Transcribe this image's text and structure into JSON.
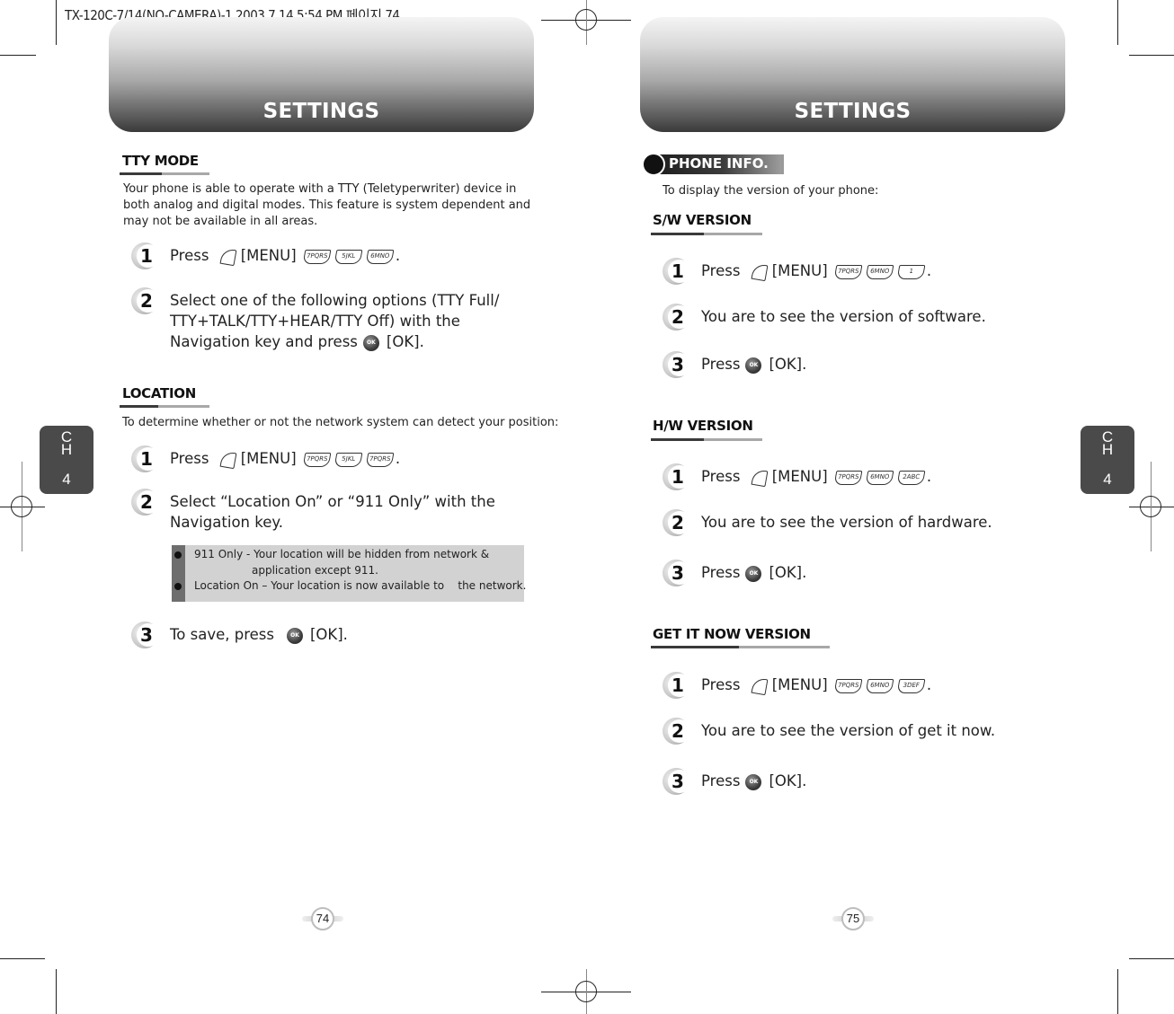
{
  "print_header": "TX-120C-7/14(NO-CAMERA)-1  2003.7.14 5:54 PM 페이지 74",
  "left_page": {
    "banner_title": "SETTINGS",
    "chapter_tab": {
      "letters": "C\nH",
      "number": "4"
    },
    "page_number": "74",
    "tty_mode": {
      "heading": "TTY MODE",
      "description": [
        "Your phone is able to operate with a TTY (Teletyperwriter) device in",
        "both analog and digital modes. This feature is system dependent and",
        "may not be available in all areas."
      ],
      "steps": [
        {
          "num": "1",
          "prefix": "Press",
          "menu": "[MENU]",
          "keys": [
            "7PQRS",
            "5JKL",
            "6MNO"
          ],
          "suffix": "."
        },
        {
          "num": "2",
          "lines": [
            "Select one of the following options (TTY Full/",
            "TTY+TALK/TTY+HEAR/TTY Off) with the",
            "Navigation key and press"
          ],
          "ok_label": "[OK]."
        }
      ]
    },
    "location": {
      "heading": "LOCATION",
      "description": "To determine whether or not the network system can detect your position:",
      "steps": [
        {
          "num": "1",
          "prefix": "Press",
          "menu": "[MENU]",
          "keys": [
            "7PQRS",
            "5JKL",
            "7PQRS"
          ],
          "suffix": "."
        },
        {
          "num": "2",
          "lines": [
            "Select “Location On” or “911 Only” with the",
            "Navigation key."
          ]
        },
        {
          "num": "3",
          "prefix": "To save, press",
          "ok_label": "[OK]."
        }
      ],
      "notes": [
        {
          "line1": "911 Only - Your location will be hidden from network &",
          "line2": "application except 911."
        },
        {
          "line1": "Location On – Your location is now available to    the network."
        }
      ]
    }
  },
  "right_page": {
    "banner_title": "SETTINGS",
    "chapter_tab": {
      "letters": "C\nH",
      "number": "4"
    },
    "page_number": "75",
    "phone_info": {
      "badge": "PHONE INFO.",
      "description": "To display the version of your phone:"
    },
    "sections": [
      {
        "heading": "S/W VERSION",
        "step1": {
          "prefix": "Press",
          "menu": "[MENU]",
          "keys": [
            "7PQRS",
            "6MNO",
            "1"
          ],
          "suffix": "."
        },
        "step2": "You are to see the version of software.",
        "step3": {
          "prefix": "Press",
          "ok_label": "[OK]."
        }
      },
      {
        "heading": "H/W VERSION",
        "step1": {
          "prefix": "Press",
          "menu": "[MENU]",
          "keys": [
            "7PQRS",
            "6MNO",
            "2ABC"
          ],
          "suffix": "."
        },
        "step2": "You are to see the version of hardware.",
        "step3": {
          "prefix": "Press",
          "ok_label": "[OK]."
        }
      },
      {
        "heading": "GET IT NOW VERSION",
        "step1": {
          "prefix": "Press",
          "menu": "[MENU]",
          "keys": [
            "7PQRS",
            "6MNO",
            "3DEF"
          ],
          "suffix": "."
        },
        "step2": "You are to see the version of get it now.",
        "step3": {
          "prefix": "Press",
          "ok_label": "[OK]."
        }
      }
    ]
  },
  "step_numbers": {
    "one": "1",
    "two": "2",
    "three": "3"
  },
  "key_glyph_ok": "OK"
}
